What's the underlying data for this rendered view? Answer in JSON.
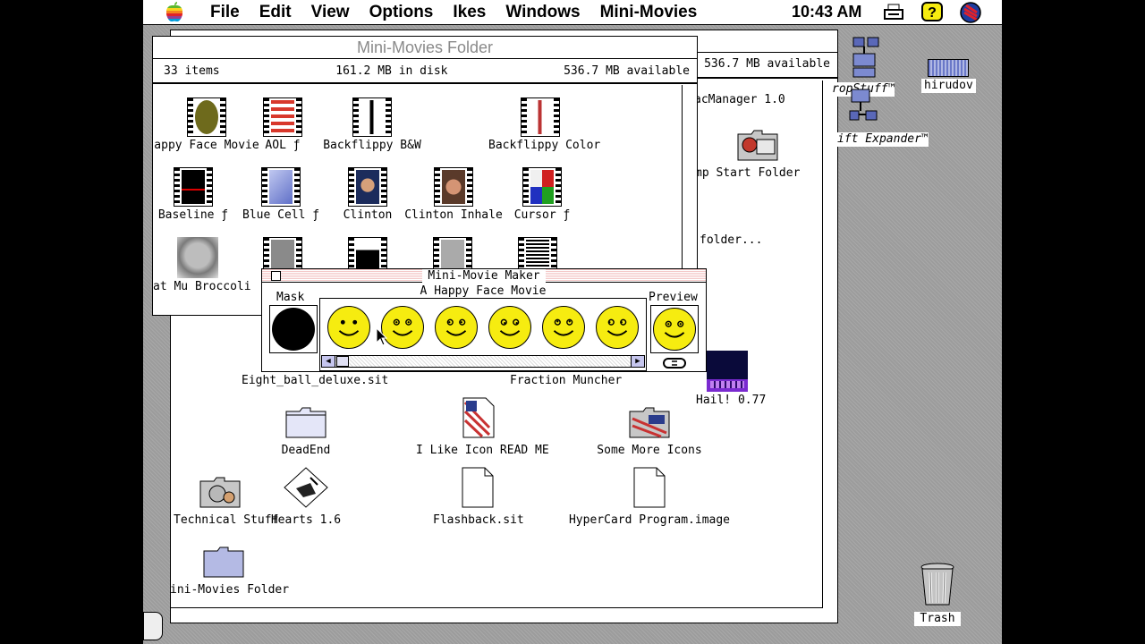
{
  "menubar": {
    "items": [
      "File",
      "Edit",
      "View",
      "Options",
      "Ikes",
      "Windows",
      "Mini-Movies"
    ],
    "clock": "10:43 AM"
  },
  "back_window": {
    "available": "536.7 MB available",
    "items": [
      "acManager 1.0",
      "mp Start Folder",
      "folder..."
    ]
  },
  "folder_window": {
    "title": "Mini-Movies Folder",
    "items_count": "33 items",
    "in_disk": "161.2 MB in disk",
    "available": "536.7 MB available",
    "icons": [
      "appy Face Movie",
      "AOL ƒ",
      "Backflippy B&W",
      "Backflippy Color",
      "Baseline ƒ",
      "Blue Cell ƒ",
      "Clinton",
      "Clinton Inhale",
      "Cursor ƒ",
      "at Mu Broccoli"
    ]
  },
  "desktop_files": [
    "Eight_ball_deluxe.sit",
    "Fraction Muncher",
    "Hail! 0.77",
    "DeadEnd",
    "I Like Icon READ ME",
    "Some More Icons",
    "Technical Stuff",
    "Hearts 1.6",
    "Flashback.sit",
    "HyperCard Program.image",
    "ini-Movies Folder"
  ],
  "desktop_right": [
    "ropStuff™",
    "hirudov",
    "ift Expander™",
    "Trash"
  ],
  "mini_movie_maker": {
    "title": "Mini-Movie Maker",
    "mask_label": "Mask",
    "movie_name": "A Happy Face Movie",
    "preview_label": "Preview",
    "frame_count": 6
  },
  "colors": {
    "smiley_yellow": "#f6ec10",
    "desktop_gray": "#9c9c9c"
  }
}
